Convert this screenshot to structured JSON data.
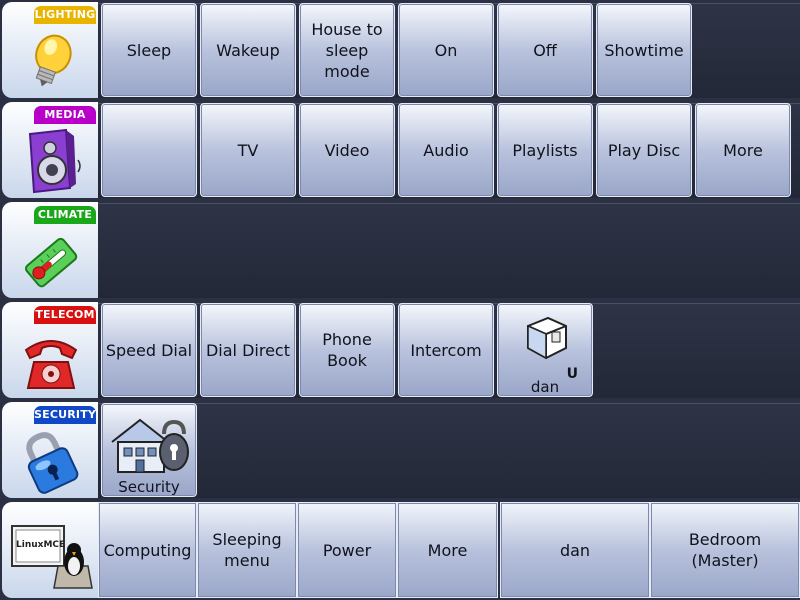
{
  "lighting": {
    "tab": "LIGHTING",
    "tab_color": "#e8b400",
    "icon": "lightbulb-icon",
    "buttons": [
      "Sleep",
      "Wakeup",
      "House to\nsleep\nmode",
      "On",
      "Off",
      "Showtime"
    ]
  },
  "media": {
    "tab": "MEDIA",
    "tab_color": "#b800c8",
    "icon": "speaker-icon",
    "buttons": [
      "",
      "TV",
      "Video",
      "Audio",
      "Playlists",
      "Play Disc",
      "More"
    ]
  },
  "climate": {
    "tab": "CLIMATE",
    "tab_color": "#1aa81a",
    "icon": "thermometer-icon",
    "buttons": []
  },
  "telecom": {
    "tab": "TELECOM",
    "tab_color": "#d81010",
    "icon": "telephone-icon",
    "buttons": [
      "Speed Dial",
      "Dial Direct",
      "Phone\nBook",
      "Intercom"
    ],
    "user_button": {
      "label": "dan",
      "badge": "U",
      "icon": "room-cube-icon"
    }
  },
  "security": {
    "tab": "SECURITY",
    "tab_color": "#1048c8",
    "icon": "padlock-icon",
    "button": {
      "label": "Security",
      "icon": "house-lock-icon"
    }
  },
  "bottom_bar": {
    "logo_text": "LinuxMCE",
    "items": [
      "Computing",
      "Sleeping\nmenu",
      "Power",
      "More"
    ],
    "user": "dan",
    "room": "Bedroom\n(Master)"
  }
}
